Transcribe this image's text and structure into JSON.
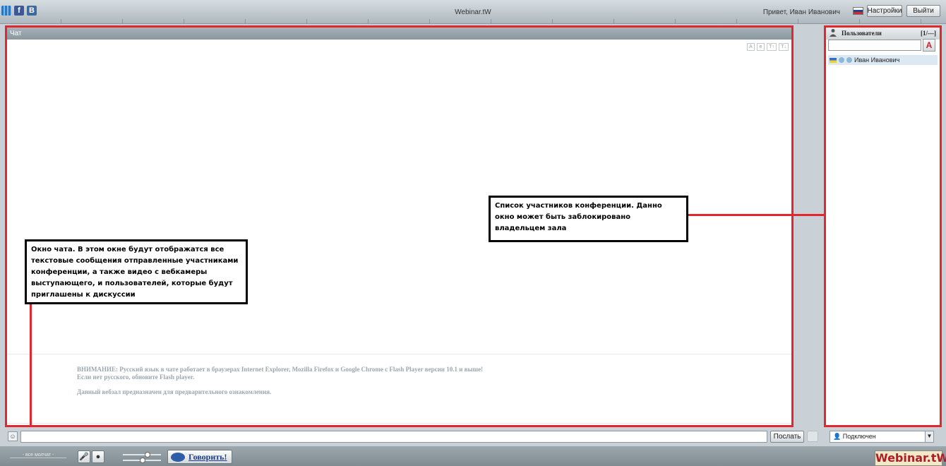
{
  "topbar": {
    "title": "Webinar.tW",
    "greeting": "Привет, Иван Иванович",
    "settings_label": "Настройки",
    "logout_label": "Выйти",
    "social": [
      "webinar-icon",
      "facebook-icon",
      "vkontakte-icon"
    ],
    "facebook_glyph": "f",
    "vk_glyph": "B"
  },
  "chat": {
    "header": "Чат",
    "notice_line1": "ВНИМАНИЕ: Русский язык  в чате работает в браузерах Internet Explorer, Mozilla Firefox и Google Chrome с Flash Player версии 10.1 и выше!",
    "notice_line2": "Если нет русского, обновите Flash player.",
    "notice_line3": "Данный вебзал предназначен для предварительного ознакомления.",
    "send_label": "Послать"
  },
  "users": {
    "header": "Пользователи",
    "count": "[1/—]",
    "sort_label": "A",
    "list": [
      {
        "name": "Иван Иванович",
        "flag": "ua-flag-icon"
      }
    ],
    "status": "Подключен"
  },
  "bottom": {
    "all_silent": "- все молчат -",
    "speak_label": "Говорить!",
    "logo": "Webinar.tW"
  },
  "annotations": {
    "chat_note": "Окно чата. В этом окне будут отображатся все текстовые сообщения отправленные участниками конференции, а также видео с вебкамеры выступающего, и пользователей, которые будут приглашены к дискуссии",
    "users_note": "Список участников конференции. Данно окно может быть заблокировано владельцем зала"
  },
  "colors": {
    "highlight": "#e0282e",
    "panel_header": "#8b979e",
    "logo_text": "#b01c26"
  }
}
